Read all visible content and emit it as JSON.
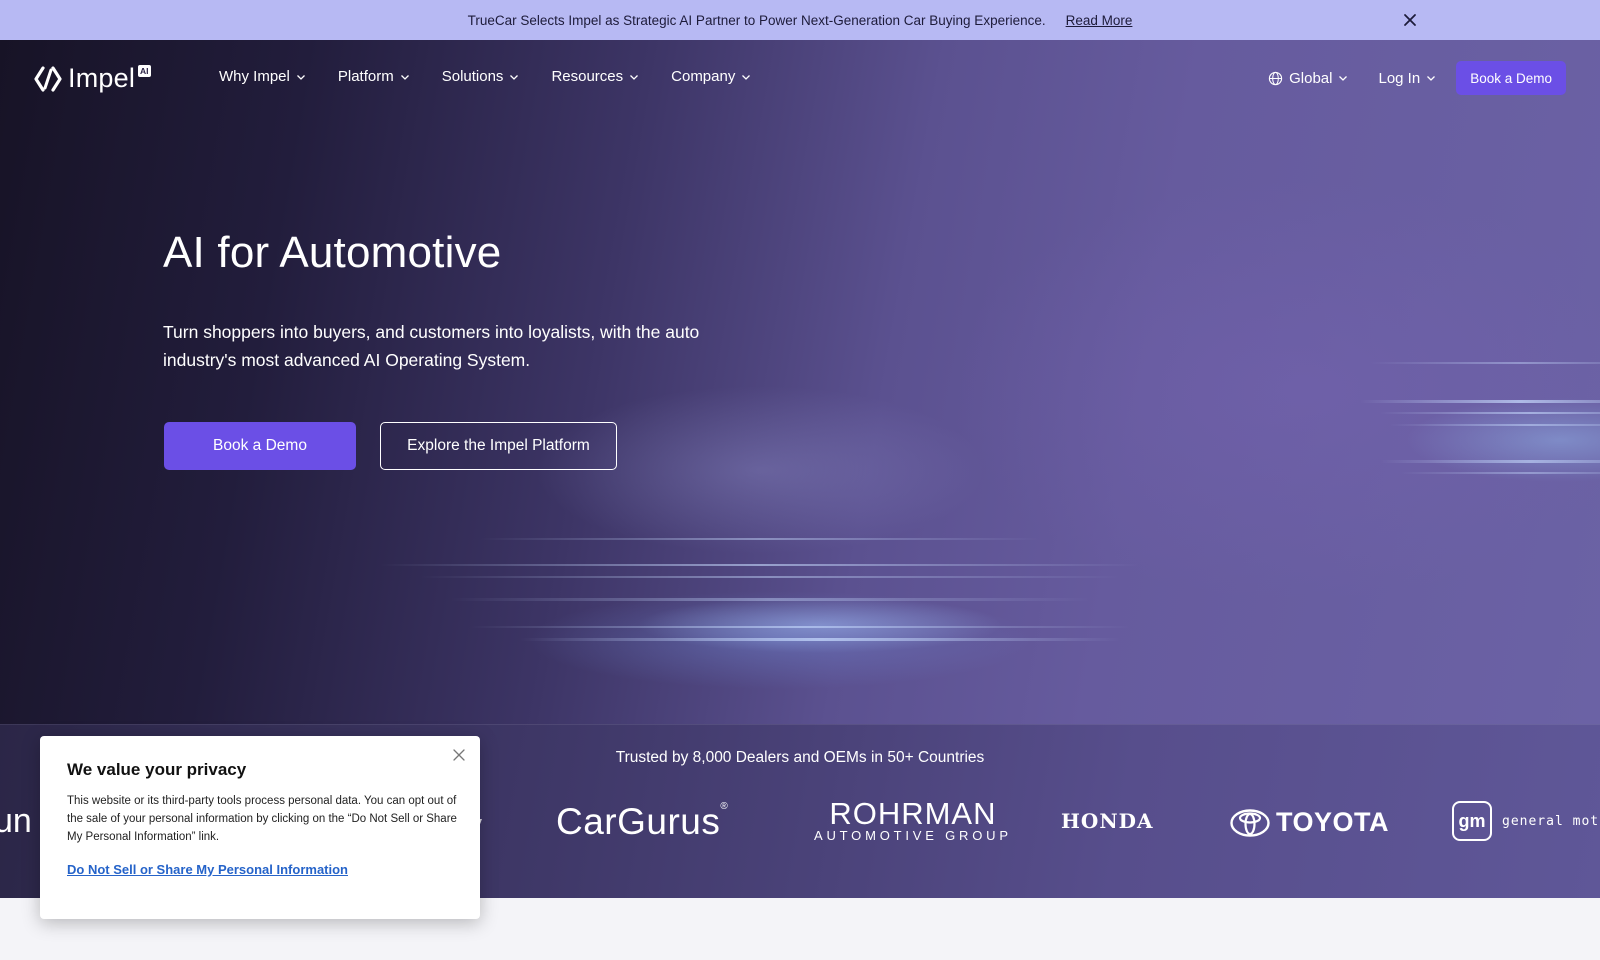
{
  "announcement": {
    "message": "TrueCar Selects Impel as Strategic AI Partner to Power Next-Generation Car Buying Experience.",
    "link": "Read More",
    "close_icon": "close-icon"
  },
  "nav": {
    "logo_text": "Impel",
    "logo_badge": "AI",
    "items": [
      {
        "label": "Why Impel"
      },
      {
        "label": "Platform"
      },
      {
        "label": "Solutions"
      },
      {
        "label": "Resources"
      },
      {
        "label": "Company"
      }
    ],
    "region": "Global",
    "login": "Log In",
    "cta": "Book a Demo"
  },
  "hero": {
    "title": "AI for Automotive",
    "subtitle": "Turn shoppers into buyers, and customers into loyalists, with the auto industry's most advanced AI Operating System.",
    "primary_button": "Book a Demo",
    "secondary_button": "Explore the Impel Platform"
  },
  "trusted": {
    "title": "Trusted by 8,000 Dealers and OEMs in 50+ Countries",
    "brands": {
      "partial_left": "un",
      "partial_mid": "y",
      "cargurus": "CarGurus",
      "cargurus_mark": "®",
      "rohrman_line1": "ROHRMAN",
      "rohrman_line2": "AUTOMOTIVE GROUP",
      "honda": "HONDA",
      "toyota": "TOYOTA",
      "gm_mark": "gm",
      "gm_text": "general motors"
    }
  },
  "privacy": {
    "title": "We value your privacy",
    "body": "This website or its third-party tools process personal data. You can opt out of the sale of your personal information by clicking on the “Do Not Sell or Share My Personal Information” link.",
    "link": "Do Not Sell or Share My Personal Information"
  },
  "colors": {
    "accent": "#6b4fe6",
    "announcement_bg": "#b7b9f3",
    "link_blue": "#2563c9"
  }
}
